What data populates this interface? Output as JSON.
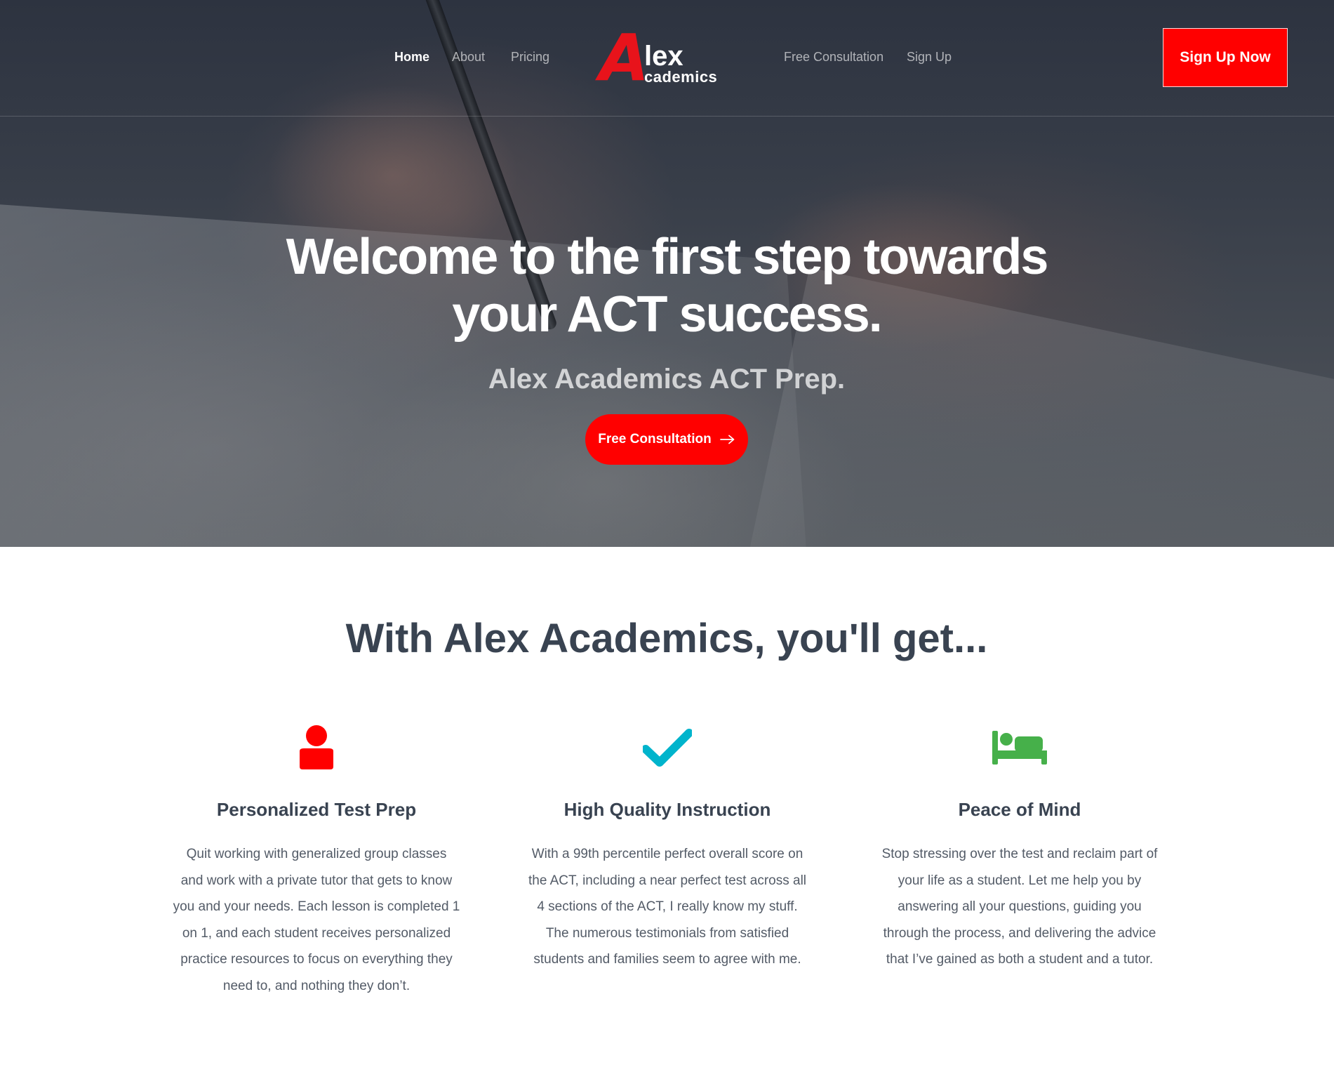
{
  "nav": {
    "left_links": [
      {
        "label": "Home",
        "active": true
      },
      {
        "label": "About",
        "active": false
      },
      {
        "label": "Pricing",
        "active": false
      }
    ],
    "right_links": [
      {
        "label": "Free Consultation",
        "active": false
      },
      {
        "label": "Sign Up",
        "active": false
      }
    ],
    "logo": {
      "a": "A",
      "lex": "lex",
      "cademics": "cademics"
    },
    "signup_button": "Sign Up Now"
  },
  "hero": {
    "title_line1": "Welcome to the first step towards",
    "title_line2": "your ACT success.",
    "subtitle": "Alex Academics ACT Prep.",
    "cta_label": "Free Consultation"
  },
  "features_section": {
    "title": "With Alex Academics, you'll get...",
    "items": [
      {
        "icon": "user-icon",
        "icon_color": "#ff0000",
        "title": "Personalized Test Prep",
        "lines": [
          "Quit working with generalized group classes",
          "and work with a private tutor that gets to know",
          "you and your needs. Each lesson is completed 1",
          "on 1, and each student receives personalized",
          "practice resources to focus on everything they",
          "need to, and nothing they don’t."
        ]
      },
      {
        "icon": "checkmark-icon",
        "icon_color": "#00b4cc",
        "title": "High Quality Instruction",
        "lines": [
          "With a 99th percentile perfect overall score on",
          "the ACT, including a near perfect test across all",
          "4 sections of the ACT, I really know my stuff.",
          "The numerous testimonials from satisfied",
          "students and families seem to agree with me."
        ]
      },
      {
        "icon": "bed-icon",
        "icon_color": "#46b04a",
        "title": "Peace of Mind",
        "lines": [
          "Stop stressing over the test and reclaim part of",
          "your life as a student. Let me help you by",
          "answering all your questions, guiding you",
          "through the process, and delivering the advice",
          "that I’ve gained as both a student and a tutor."
        ]
      }
    ]
  },
  "colors": {
    "brand_red": "#ff0000",
    "heading_text": "#394351",
    "body_text": "#535b67"
  }
}
